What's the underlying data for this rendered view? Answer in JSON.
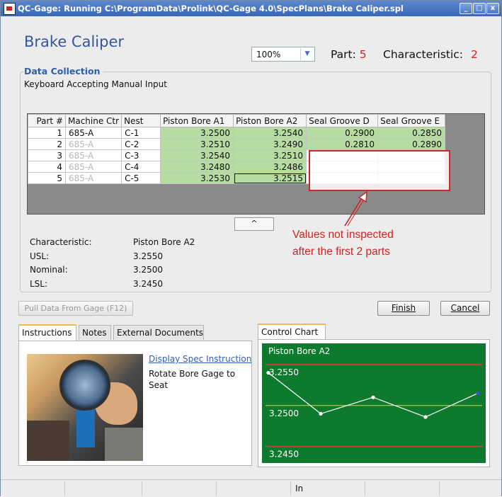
{
  "window": {
    "title": "QC-Gage: Running C:\\ProgramData\\Prolink\\QC-Gage 4.0\\SpecPlans\\Brake Caliper.spl",
    "minimize": "_",
    "maximize": "□",
    "close": "x"
  },
  "header": {
    "heading": "Brake Caliper",
    "zoom_value": "100%",
    "part_label": "Part:",
    "part_value": "5",
    "characteristic_label": "Characteristic:",
    "characteristic_value": "2"
  },
  "data_collection": {
    "group_label": "Data Collection",
    "mode_text": "Keyboard Accepting Manual Input",
    "columns": [
      "Part #",
      "Machine Ctr",
      "Nest",
      "Piston Bore A1",
      "Piston Bore A2",
      "Seal Groove D",
      "Seal Groove E"
    ],
    "rows": [
      {
        "part": "1",
        "machine": "685-A",
        "nest": "C-1",
        "a1": "3.2500",
        "a2": "3.2540",
        "d": "0.2900",
        "e": "0.2850"
      },
      {
        "part": "2",
        "machine": "685-A",
        "nest": "C-2",
        "a1": "3.2510",
        "a2": "3.2490",
        "d": "0.2810",
        "e": "0.2890"
      },
      {
        "part": "3",
        "machine": "685-A",
        "nest": "C-3",
        "a1": "3.2540",
        "a2": "3.2510",
        "d": "",
        "e": ""
      },
      {
        "part": "4",
        "machine": "685-A",
        "nest": "C-4",
        "a1": "3.2480",
        "a2": "3.2486",
        "d": "",
        "e": ""
      },
      {
        "part": "5",
        "machine": "685-A",
        "nest": "C-5",
        "a1": "3.2530",
        "a2": "3.2515",
        "d": "",
        "e": ""
      }
    ],
    "scroll_up_label": "^",
    "annotation_line1": "Values not inspected",
    "annotation_line2": "after the first 2 parts"
  },
  "spec": {
    "characteristic_label": "Characteristic:",
    "characteristic_value": "Piston Bore A2",
    "usl_label": "USL:",
    "usl_value": "3.2550",
    "nominal_label": "Nominal:",
    "nominal_value": "3.2500",
    "lsl_label": "LSL:",
    "lsl_value": "3.2450"
  },
  "buttons": {
    "pull_data": "Pull Data From Gage (F12)",
    "finish": "Finish",
    "cancel": "Cancel"
  },
  "tabs": [
    "Instructions",
    "Notes",
    "External Documents"
  ],
  "instructions": {
    "link": "Display Spec Instruction",
    "text": "Rotate Bore Gage to Seat"
  },
  "control_chart": {
    "tab_label": "Control Chart"
  },
  "chart_data": {
    "type": "line",
    "title": "Piston Bore A2",
    "x": [
      1,
      2,
      3,
      4,
      5
    ],
    "series": [
      {
        "values": [
          3.254,
          3.249,
          3.251,
          3.2486,
          3.2515
        ]
      }
    ],
    "tick_labels": [
      "3.2550",
      "3.2500",
      "3.2450"
    ],
    "limit_lines": {
      "upper": 3.255,
      "center": 3.25,
      "lower": 3.245
    },
    "ylim": [
      3.2435,
      3.2575
    ],
    "background": "#0e7a2e",
    "line_color": "#ffffff",
    "limit_color": "#b74a2a",
    "center_color": "#c9d84b"
  },
  "status_bar": {
    "segment_text": "In"
  }
}
